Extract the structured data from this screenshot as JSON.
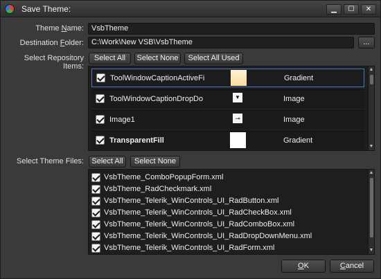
{
  "window": {
    "title": "Save Theme:",
    "minimize": "▁",
    "maximize": "☐",
    "close": "✕"
  },
  "form": {
    "theme_name_label_pre": "Theme ",
    "theme_name_label_u": "N",
    "theme_name_label_post": "ame:",
    "theme_name_value": "VsbTheme",
    "destination_label_pre": "Destination ",
    "destination_label_u": "F",
    "destination_label_post": "older:",
    "destination_value": "C:\\Work\\New VSB\\VsbTheme",
    "browse_label": "..."
  },
  "repository": {
    "label": "Select Repository Items:",
    "select_all": "Select All",
    "select_none": "Select None",
    "select_all_used": "Select All Used",
    "items": [
      {
        "name": "ToolWindowCaptionActiveFi",
        "type": "Gradient",
        "checked": true,
        "swatch": "gradient-peach"
      },
      {
        "name": "ToolWindowCaptionDropDo",
        "type": "Image",
        "checked": true,
        "swatch": "dropdown-arrow"
      },
      {
        "name": "Image1",
        "type": "Image",
        "checked": true,
        "swatch": "pin-glyph"
      },
      {
        "name": "TransparentFill",
        "type": "Gradient",
        "checked": true,
        "swatch": "white-fill"
      }
    ]
  },
  "theme_files": {
    "label": "Select Theme Files:",
    "select_all": "Select All",
    "select_none": "Select None",
    "files": [
      "VsbTheme_ComboPopupForm.xml",
      "VsbTheme_RadCheckmark.xml",
      "VsbTheme_Telerik_WinControls_UI_RadButton.xml",
      "VsbTheme_Telerik_WinControls_UI_RadCheckBox.xml",
      "VsbTheme_Telerik_WinControls_UI_RadComboBox.xml",
      "VsbTheme_Telerik_WinControls_UI_RadDropDownMenu.xml",
      "VsbTheme_Telerik_WinControls_UI_RadForm.xml"
    ]
  },
  "footer": {
    "ok_u": "O",
    "ok_rest": "K",
    "cancel_u": "C",
    "cancel_rest": "ancel"
  },
  "colors": {
    "selection_border": "#4a78c8",
    "swatch_peach": "#fde4b0"
  }
}
